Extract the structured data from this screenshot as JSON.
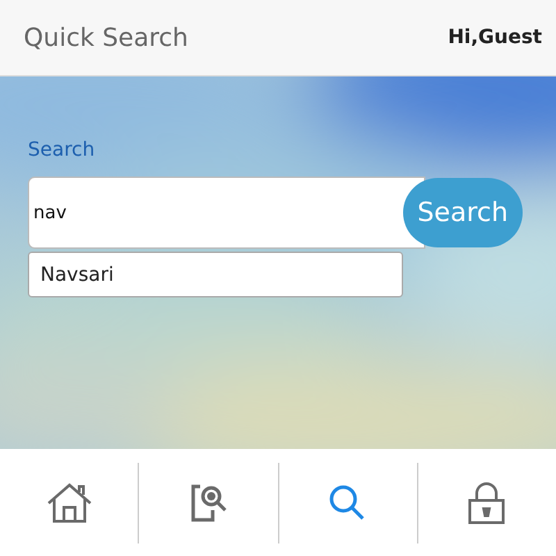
{
  "header": {
    "title": "Quick Search",
    "greeting": "Hi,Guest"
  },
  "search": {
    "label": "Search",
    "value": "nav",
    "button": "Search",
    "suggestions": [
      "Navsari"
    ]
  },
  "tabs": [
    {
      "kind": "home",
      "selected": false
    },
    {
      "kind": "document-search",
      "selected": false
    },
    {
      "kind": "search",
      "selected": true
    },
    {
      "kind": "lock",
      "selected": false
    }
  ]
}
